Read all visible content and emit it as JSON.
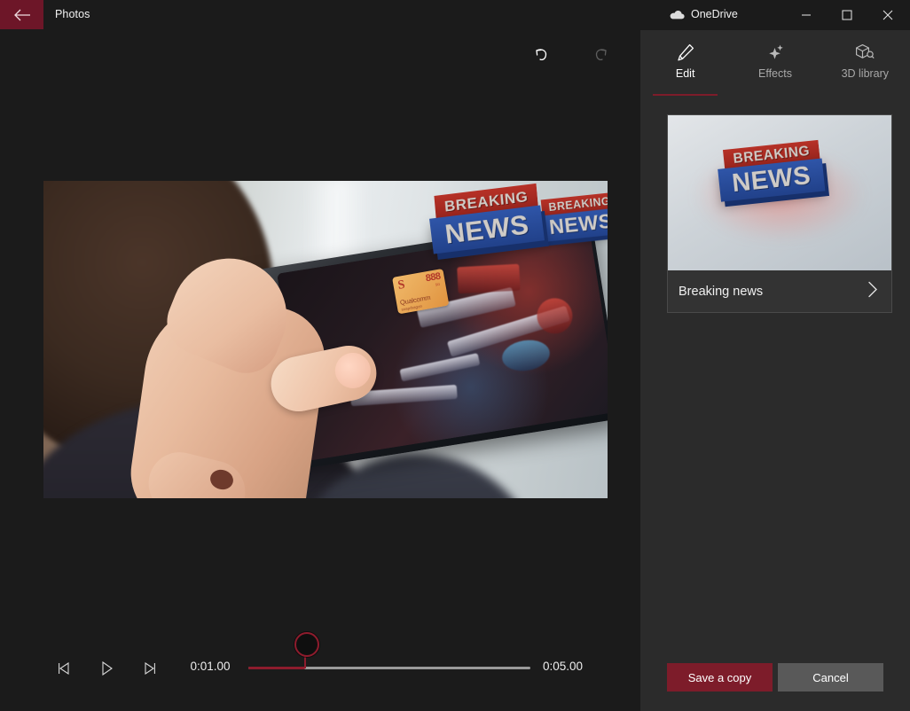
{
  "titlebar": {
    "back_icon": "back-arrow-icon",
    "app_title": "Photos",
    "onedrive_title": "OneDrive",
    "onedrive_icon": "cloud-icon",
    "minimize_label": "–",
    "maximize_label": "□",
    "close_label": "✕"
  },
  "editor": {
    "undo_icon": "undo-icon",
    "redo_icon": "redo-icon",
    "photo": {
      "description": "Person holding a smartphone displaying a game, Qualcomm Snapdragon 888 badge on screen",
      "badge": {
        "model": "888",
        "network": "5G",
        "brand": "Qualcomm",
        "sub_brand": "snapdragon",
        "logo": "S"
      },
      "overlays": [
        {
          "line1": "BREAKING",
          "line2": "NEWS"
        },
        {
          "line1": "BREAKING",
          "line2": "NEWS"
        }
      ]
    }
  },
  "transport": {
    "prev_frame_icon": "previous-frame-icon",
    "play_icon": "play-icon",
    "next_frame_icon": "next-frame-icon",
    "current_time": "0:01.00",
    "total_time": "0:05.00",
    "progress_percent": 20,
    "accent_color": "#8e1c2d",
    "track_color": "#9a9a9a"
  },
  "panel": {
    "tabs": [
      {
        "label": "Edit",
        "icon": "pencil-icon",
        "active": true
      },
      {
        "label": "Effects",
        "icon": "sparkles-icon",
        "active": false
      },
      {
        "label": "3D library",
        "icon": "cube-search-icon",
        "active": false
      }
    ],
    "card": {
      "label": "Breaking news",
      "chevron_icon": "chevron-right-icon",
      "thumbnail": {
        "line1": "BREAKING",
        "line2": "NEWS"
      }
    },
    "save_label": "Save a copy",
    "cancel_label": "Cancel"
  },
  "colors": {
    "accent_red": "#7d1c2a",
    "panel_bg": "#2b2b2b",
    "editor_bg": "#1b1b1b",
    "secondary_btn": "#595959"
  }
}
